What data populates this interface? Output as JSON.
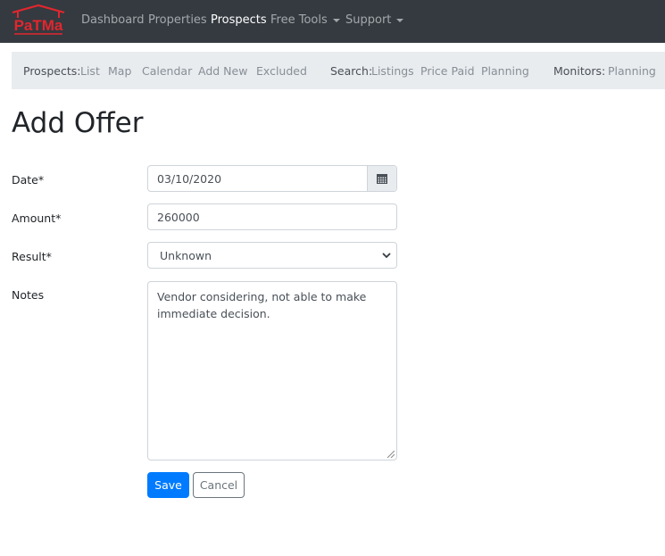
{
  "brand": {
    "logo_text": "PaTMa",
    "logo_color": "#e3262d"
  },
  "navbar": {
    "items": [
      {
        "label": "Dashboard",
        "active": false
      },
      {
        "label": "Properties",
        "active": false
      },
      {
        "label": "Prospects",
        "active": true
      },
      {
        "label": "Free Tools",
        "active": false,
        "dropdown": true
      },
      {
        "label": "Support",
        "active": false,
        "dropdown": true
      }
    ]
  },
  "subnav": {
    "prospects_label": "Prospects:",
    "prospects_links": [
      "List",
      "Map",
      "Calendar",
      "Add New",
      "Excluded"
    ],
    "search_label": "Search:",
    "search_links": [
      "Listings",
      "Price Paid",
      "Planning"
    ],
    "monitors_label": "Monitors:",
    "monitors_links": [
      "Planning"
    ]
  },
  "page": {
    "title": "Add Offer"
  },
  "form": {
    "date": {
      "label": "Date*",
      "value": "03/10/2020",
      "icon": "calendar-icon"
    },
    "amount": {
      "label": "Amount*",
      "value": "260000"
    },
    "result": {
      "label": "Result*",
      "value": "Unknown"
    },
    "notes": {
      "label": "Notes",
      "value": "Vendor considering, not able to make immediate decision."
    },
    "save_label": "Save",
    "cancel_label": "Cancel"
  },
  "colors": {
    "primary": "#007bff",
    "navbar_bg": "#343a40",
    "subnav_bg": "#e9ecef"
  }
}
